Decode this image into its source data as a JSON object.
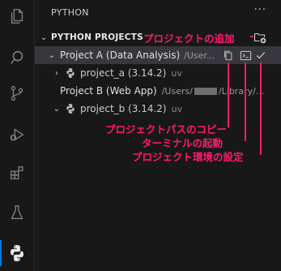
{
  "sidebar": {
    "title": "PYTHON",
    "more_label": "···"
  },
  "section": {
    "header": "PYTHON PROJECTS"
  },
  "projects": [
    {
      "name": "Project A (Data Analysis)",
      "path": "/User...",
      "env": {
        "name": "project_a (3.14.2)",
        "manager": "uv"
      }
    },
    {
      "name": "Project B (Web App)",
      "path_start": "/Users/",
      "path_end": "/Library/...",
      "env": {
        "name": "project_b (3.14.2)",
        "manager": "uv"
      }
    }
  ],
  "annotations": {
    "add_project": "プロジェクトの追加",
    "copy_path": "プロジェクトパスのコピー",
    "open_terminal": "ターミナルの起動",
    "set_env": "プロジェクト環境の設定"
  },
  "colors": {
    "background": "#181818",
    "selection": "#37373d",
    "annotation": "#ff1a6e",
    "activity_indicator": "#0078d4"
  },
  "icons": {
    "activity_bar": [
      "explorer-icon",
      "search-icon",
      "source-control-icon",
      "run-debug-icon",
      "extensions-icon",
      "testing-icon",
      "python-icon"
    ],
    "project_actions": [
      "copy-icon",
      "terminal-icon",
      "check-icon"
    ],
    "section_action": "add-project-icon"
  }
}
